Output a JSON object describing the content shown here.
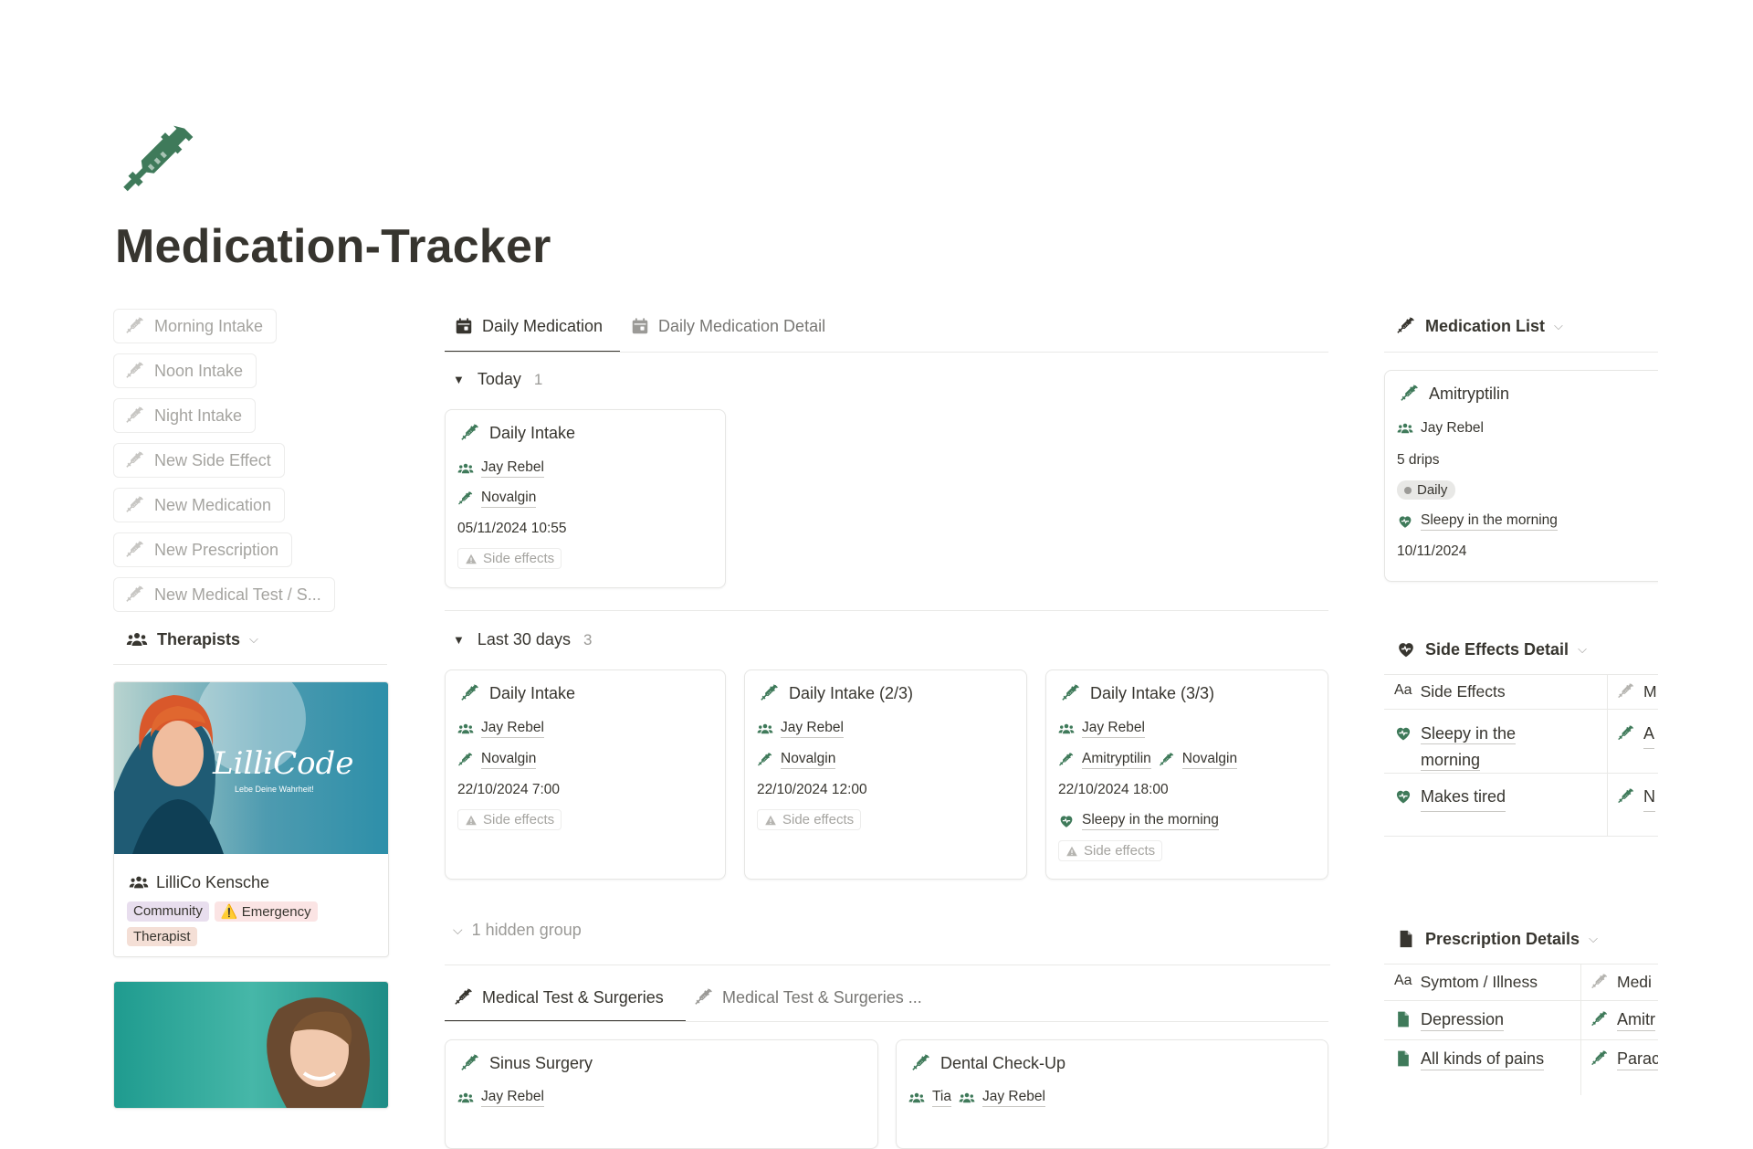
{
  "page": {
    "title": "Medication-Tracker"
  },
  "colors": {
    "accent_green": "#3f7a5a",
    "text": "#37352f",
    "muted": "#9b9a97"
  },
  "quick_buttons": [
    {
      "label": "Morning Intake",
      "icon": "syringe-icon"
    },
    {
      "label": "Noon Intake",
      "icon": "syringe-icon"
    },
    {
      "label": "Night Intake",
      "icon": "syringe-icon"
    },
    {
      "label": "New Side Effect",
      "icon": "syringe-icon"
    },
    {
      "label": "New Medication",
      "icon": "syringe-icon"
    },
    {
      "label": "New Prescription",
      "icon": "syringe-icon"
    },
    {
      "label": "New Medical Test / S...",
      "icon": "syringe-icon"
    }
  ],
  "therapists": {
    "title": "Therapists",
    "cards": [
      {
        "name": "LilliCo Kensche",
        "photo_text": "LilliCode",
        "photo_subtext": "Lebe Deine Wahrheit!",
        "tags": [
          {
            "label": "Community",
            "color": "#e8deee"
          },
          {
            "label": "⚠️ Emergency",
            "color": "#fbe4e4"
          },
          {
            "label": "Therapist",
            "color": "#f4dfd6"
          }
        ]
      }
    ]
  },
  "daily_medication": {
    "tabs": [
      {
        "label": "Daily Medication",
        "active": true,
        "icon": "calendar-icon"
      },
      {
        "label": "Daily Medication Detail",
        "active": false,
        "icon": "calendar-icon"
      }
    ],
    "groups": [
      {
        "label": "Today",
        "count": "1",
        "cards": [
          {
            "title": "Daily Intake",
            "person": "Jay Rebel",
            "meds": [
              "Novalgin"
            ],
            "datetime": "05/11/2024 10:55",
            "side_effect": "",
            "side_effects_label": "Side effects"
          }
        ]
      },
      {
        "label": "Last 30 days",
        "count": "3",
        "cards": [
          {
            "title": "Daily Intake",
            "person": "Jay Rebel",
            "meds": [
              "Novalgin"
            ],
            "datetime": "22/10/2024 7:00",
            "side_effect": "",
            "side_effects_label": "Side effects"
          },
          {
            "title": "Daily Intake (2/3)",
            "person": "Jay Rebel",
            "meds": [
              "Novalgin"
            ],
            "datetime": "22/10/2024 12:00",
            "side_effect": "",
            "side_effects_label": "Side effects"
          },
          {
            "title": "Daily Intake (3/3)",
            "person": "Jay Rebel",
            "meds": [
              "Amitryptilin",
              "Novalgin"
            ],
            "datetime": "22/10/2024 18:00",
            "side_effect": "Sleepy in the morning",
            "side_effects_label": "Side effects"
          }
        ]
      }
    ],
    "hidden_groups": "1 hidden group"
  },
  "medical_tests": {
    "tabs": [
      {
        "label": "Medical Test & Surgeries",
        "active": true
      },
      {
        "label": "Medical Test & Surgeries ...",
        "active": false
      }
    ],
    "cards": [
      {
        "title": "Sinus Surgery",
        "people": [
          "Jay Rebel"
        ]
      },
      {
        "title": "Dental Check-Up",
        "people": [
          "Tia",
          "Jay Rebel"
        ]
      }
    ]
  },
  "medication_list": {
    "title": "Medication List",
    "card": {
      "title": "Amitryptilin",
      "person": "Jay Rebel",
      "dose": "5 drips",
      "frequency": "Daily",
      "side_effect": "Sleepy in the morning",
      "date": "10/11/2024"
    }
  },
  "side_effects_detail": {
    "title": "Side Effects Detail",
    "columns": [
      "Side Effects",
      "M"
    ],
    "rows": [
      {
        "name_line1": "Sleepy in the",
        "name_line2": "morning",
        "med": "A"
      },
      {
        "name_line1": "Makes tired",
        "name_line2": "",
        "med": "N"
      }
    ]
  },
  "prescription_details": {
    "title": "Prescription Details",
    "columns": [
      "Symtom / Illness",
      "Medi"
    ],
    "rows": [
      {
        "name": "Depression",
        "med": "Amitr"
      },
      {
        "name": "All kinds of pains",
        "med": "Parac"
      }
    ]
  }
}
